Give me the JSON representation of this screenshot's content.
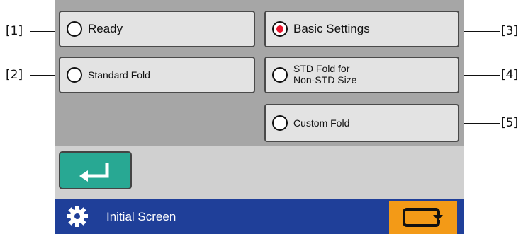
{
  "options": {
    "ready": {
      "label": "Ready",
      "selected": false
    },
    "basic_settings": {
      "label": "Basic Settings",
      "selected": true
    },
    "standard_fold": {
      "label": "Standard Fold",
      "selected": false
    },
    "std_fold_non_std": {
      "label_line1": "STD Fold for",
      "label_line2": "Non-STD Size",
      "selected": false
    },
    "custom_fold": {
      "label": "Custom Fold",
      "selected": false
    }
  },
  "status_bar": {
    "title": "Initial Screen",
    "icon": "gear-icon"
  },
  "return_button": {
    "icon": "return-arrow-icon"
  },
  "mode_button": {
    "icon": "switch-screen-icon"
  },
  "callouts": {
    "c1": "[1]",
    "c2": "[2]",
    "c3": "[3]",
    "c4": "[4]",
    "c5": "[5]"
  },
  "colors": {
    "screen_bg": "#a6a6a6",
    "button_bg": "#e3e3e3",
    "selected_dot": "#e8122a",
    "return_button": "#28a893",
    "status_bar": "#1f3f99",
    "mode_button": "#f39a17"
  }
}
